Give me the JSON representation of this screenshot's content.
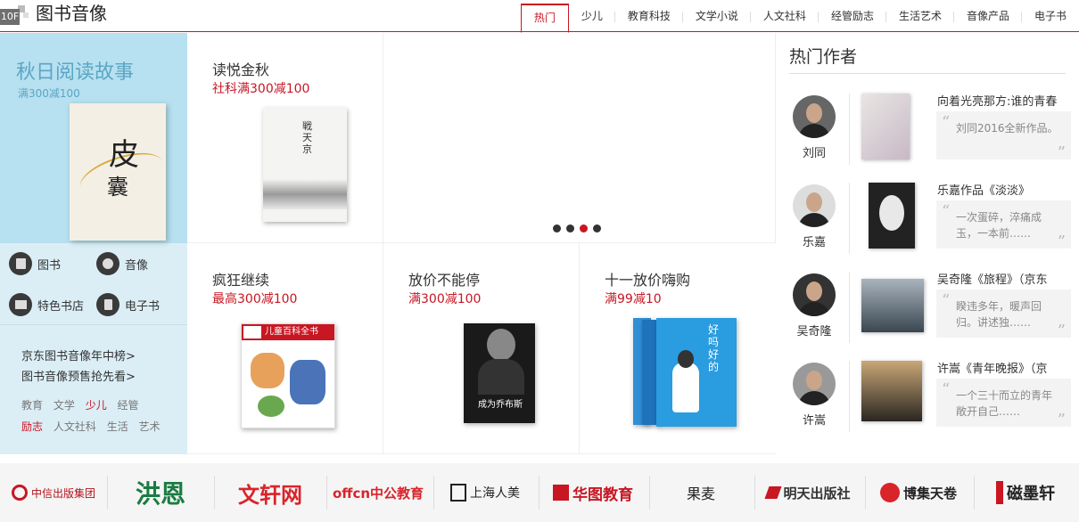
{
  "header": {
    "floor": "10F",
    "title": "图书音像",
    "tabs": [
      "热门",
      "少儿",
      "教育科技",
      "文学小说",
      "人文社科",
      "经管励志",
      "生活艺术",
      "音像产品",
      "电子书"
    ]
  },
  "promo": {
    "title": "秋日阅读故事",
    "subtitle": "满300减100",
    "book_char1": "皮",
    "book_char2": "囊"
  },
  "categories": {
    "book": "图书",
    "audio": "音像",
    "store": "特色书店",
    "ebook": "电子书"
  },
  "links": {
    "rank": "京东图书音像年中榜>",
    "presale": "图书音像预售抢先看>"
  },
  "tags": [
    "教育",
    "文学",
    "少儿",
    "经管",
    "励志",
    "人文社科",
    "生活",
    "艺术"
  ],
  "cells": {
    "c1": {
      "title": "读悦金秋",
      "sub": "社科满300减100"
    },
    "c2": {
      "title": "疯狂继续",
      "sub": "最高300减100"
    },
    "c3": {
      "title": "放价不能停",
      "sub": "满300减100"
    },
    "c4": {
      "title": "十一放价嗨购",
      "sub": "满99减10"
    }
  },
  "book_texts": {
    "c1": "戦天京",
    "dk": "儿童百科全书",
    "jobs": "成为乔布斯",
    "haoma": "好吗好的"
  },
  "authors": {
    "title": "热门作者",
    "list": [
      {
        "name": "刘同",
        "book": "向着光亮那方:谁的青春",
        "quote": "刘同2016全新作品。"
      },
      {
        "name": "乐嘉",
        "book": "乐嘉作品《淡淡》",
        "quote": "一次蛋碎，淬痛成玉，一本前……"
      },
      {
        "name": "吴奇隆",
        "book": "吴奇隆《旅程》（京东",
        "quote": "睽违多年，暖声回归。讲述独……"
      },
      {
        "name": "许嵩",
        "book": "许嵩《青年晚报》（京",
        "quote": "一个三十而立的青年敞开自己……"
      }
    ]
  },
  "brands": [
    "中信出版集团",
    "洪恩",
    "文轩网",
    "offcn中公教育",
    "上海人美",
    "华图教育",
    "果麦",
    "明天出版社",
    "博集天卷",
    "磁墨轩"
  ],
  "colors": {
    "accent": "#c81623",
    "promo_bg": "#b7e0f0",
    "left_bg": "#dbeef6"
  }
}
